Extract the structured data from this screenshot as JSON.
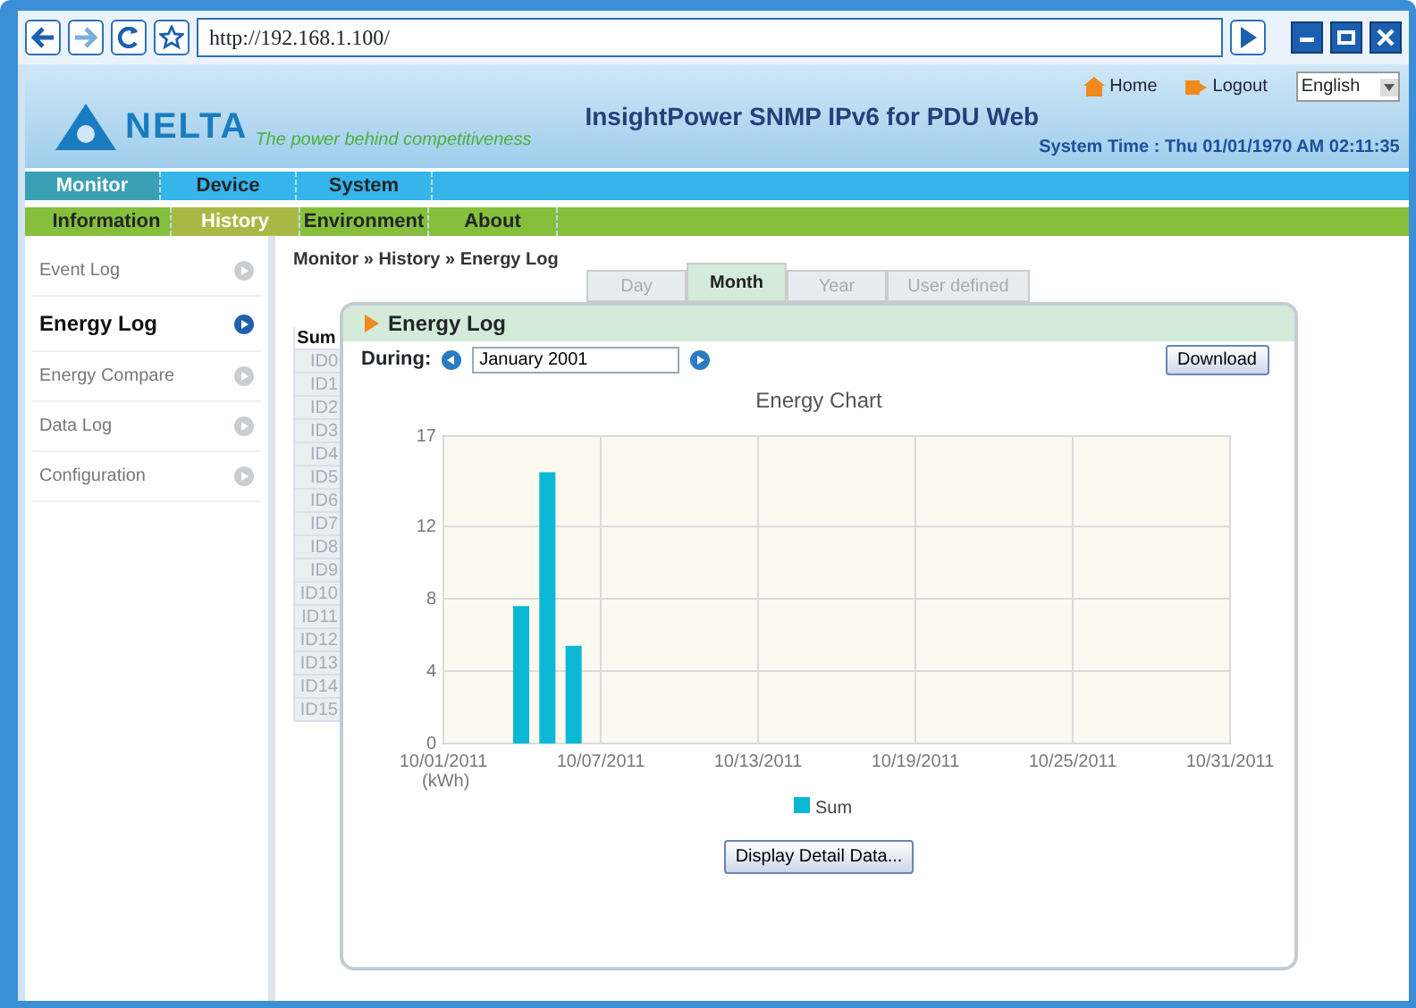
{
  "browser": {
    "url": "http://192.168.1.100/"
  },
  "header": {
    "logo_text": "NELTA",
    "tagline": "The power behind competitiveness",
    "title": "InsightPower SNMP IPv6 for PDU Web",
    "links": [
      "Home",
      "Logout"
    ],
    "language": "English",
    "system_time": "System Time : Thu 01/01/1970 AM 02:11:35"
  },
  "main_menu": [
    {
      "label": "Monitor",
      "selected": true
    },
    {
      "label": "Device",
      "selected": false
    },
    {
      "label": "System",
      "selected": false
    }
  ],
  "sub_menu": [
    {
      "label": "Information",
      "selected": false
    },
    {
      "label": "History",
      "selected": true
    },
    {
      "label": "Environment",
      "selected": false
    },
    {
      "label": "About",
      "selected": false
    }
  ],
  "sidebar": {
    "items": [
      {
        "label": "Event Log",
        "selected": false
      },
      {
        "label": "Energy Log",
        "selected": true
      },
      {
        "label": "Energy Compare",
        "selected": false
      },
      {
        "label": "Data Log",
        "selected": false
      },
      {
        "label": "Configuration",
        "selected": false
      }
    ]
  },
  "breadcrumb": "Monitor » History » Energy Log",
  "tabs": [
    {
      "label": "Day",
      "selected": false
    },
    {
      "label": "Month",
      "selected": true
    },
    {
      "label": "Year",
      "selected": false
    },
    {
      "label": "User defined",
      "selected": false
    }
  ],
  "id_list": [
    {
      "label": "Sum",
      "selected": true
    },
    {
      "label": "ID0",
      "selected": false
    },
    {
      "label": "ID1",
      "selected": false
    },
    {
      "label": "ID2",
      "selected": false
    },
    {
      "label": "ID3",
      "selected": false
    },
    {
      "label": "ID4",
      "selected": false
    },
    {
      "label": "ID5",
      "selected": false
    },
    {
      "label": "ID6",
      "selected": false
    },
    {
      "label": "ID7",
      "selected": false
    },
    {
      "label": "ID8",
      "selected": false
    },
    {
      "label": "ID9",
      "selected": false
    },
    {
      "label": "ID10",
      "selected": false
    },
    {
      "label": "ID11",
      "selected": false
    },
    {
      "label": "ID12",
      "selected": false
    },
    {
      "label": "ID13",
      "selected": false
    },
    {
      "label": "ID14",
      "selected": false
    },
    {
      "label": "ID15",
      "selected": false
    }
  ],
  "panel": {
    "title": "Energy Log",
    "during_label": "During:",
    "during_value": "January 2001",
    "download": "Download",
    "detail_button": "Display Detail Data...",
    "chart_data": {
      "type": "bar",
      "title": "Energy Chart",
      "ylabel": "(kWh)",
      "categories": [
        "10/01/2011",
        null,
        null,
        null,
        null,
        null,
        "10/07/2011",
        null,
        null,
        null,
        null,
        null,
        "10/13/2011",
        null,
        null,
        null,
        null,
        null,
        "10/19/2011",
        null,
        null,
        null,
        null,
        null,
        "10/25/2011",
        null,
        null,
        null,
        null,
        null,
        "10/31/2011"
      ],
      "series": [
        {
          "name": "Sum",
          "color": "#0ab8d6",
          "values": [
            null,
            null,
            null,
            7.6,
            15,
            5.4,
            null,
            null,
            null,
            null,
            null,
            null,
            null,
            null,
            null,
            null,
            null,
            null,
            null,
            null,
            null,
            null,
            null,
            null,
            null,
            null,
            null,
            null,
            null,
            null,
            null
          ]
        }
      ],
      "ylim": [
        0,
        17
      ],
      "grid": true,
      "yticks": [
        0,
        4,
        8,
        12,
        17
      ]
    }
  }
}
